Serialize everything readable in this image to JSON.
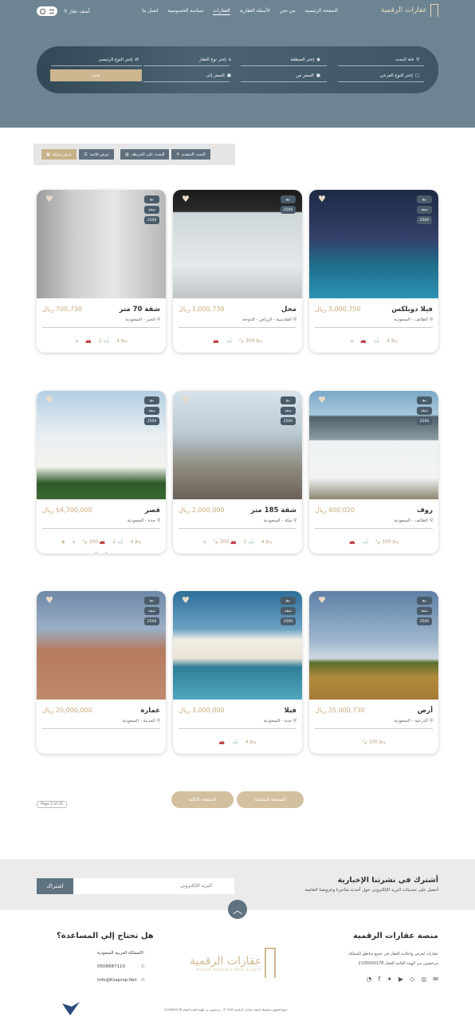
{
  "header": {
    "logo": "عقارات الرقمية",
    "nav": [
      "الصفحة الرئيسية",
      "من نحن",
      "الأسئلة العقارية",
      "العقارات",
      "سياسة الخصوصية",
      "اتصل بنا"
    ],
    "add_property": "أضف عقار"
  },
  "search": {
    "f1": "فئة البحث",
    "f2": "إختر المنطقة",
    "f3": "إختر نوع العقار",
    "f4": "إختر النوع الرئيسي",
    "f5": "إختر النوع الفرعي",
    "f6": "السعر من",
    "f7": "السعر إلى",
    "button": "بحث"
  },
  "toolbar": {
    "grid": "عرض شبكة",
    "list": "عرض قائمة",
    "map": "البحث على الخريطة",
    "advanced": "البحث المتقدم"
  },
  "listings": [
    {
      "title": "فيلا دوبلكس",
      "price": "3,000,750 ريال",
      "loc": "الطائف - السعودية",
      "tags": [
        "بيع",
        "شقة",
        "2500"
      ],
      "feats": [
        "4",
        "",
        "",
        ""
      ],
      "feats2": []
    },
    {
      "title": "محل",
      "price": "1,000,730 ريال",
      "loc": "القادسية - الرياض - الدوحة",
      "tags": [
        "بيع",
        "2500"
      ],
      "feats": [
        "300 م²",
        "",
        ""
      ],
      "feats2": []
    },
    {
      "title": "شقة 70 متر",
      "price": "700,730 ريال",
      "loc": "الخبر - السعودية",
      "tags": [
        "بيع",
        "شقة",
        "2500"
      ],
      "feats": [
        "4",
        "2",
        "",
        ""
      ],
      "feats2": []
    },
    {
      "title": "روف",
      "price": "400,020 ريال",
      "loc": "الطائف - السعودية",
      "tags": [
        "بيع",
        "شقة",
        "2500"
      ],
      "feats": [
        "300 م²",
        "",
        ""
      ],
      "feats2": []
    },
    {
      "title": "شقة 185 متر",
      "price": "2,000,000 ريال",
      "loc": "مكة - السعودية",
      "tags": [
        "بيع",
        "شقة",
        "2500"
      ],
      "feats": [
        "4",
        "2",
        "300 م²",
        ""
      ],
      "feats2": []
    },
    {
      "title": "قصر",
      "price": "$4,700,000 ريال",
      "loc": "جدة - السعودية",
      "tags": [
        "بيع",
        "شقة",
        "2500"
      ],
      "feats": [
        "4",
        "2",
        "300 م²",
        "",
        ""
      ],
      "feats2": [
        "",
        ""
      ]
    },
    {
      "title": "أرض",
      "price": "35,000,730 ريال",
      "loc": "الدرعية - السعودية",
      "tags": [
        "بيع",
        "شقة",
        "2500"
      ],
      "feats": [
        "300 م²"
      ],
      "feats2": []
    },
    {
      "title": "فيلا",
      "price": "3,000,000 ريال",
      "loc": "جدة - السعودية",
      "tags": [
        "بيع",
        "شقة",
        "2500"
      ],
      "feats": [
        "4",
        "",
        ""
      ],
      "feats2": []
    },
    {
      "title": "عمارة",
      "price": "20,000,000 ريال",
      "loc": "المدينة - السعودية",
      "tags": [
        "بيع",
        "شقة",
        "2500"
      ],
      "feats": [],
      "feats2": []
    }
  ],
  "pagination": {
    "label": "Page 2 of 45",
    "prev": "الصفحة السابقة",
    "next": "الصفحة التالية"
  },
  "newsletter": {
    "title": "أشترك في نشرتنا الإخبارية",
    "subtitle": "أحصل على تحديثات البريد الإلكتروني حول أحدث متاجرنا وعروضنا الخاصة",
    "placeholder": "البريد الإلكتروني",
    "button": "اشتراك"
  },
  "footer": {
    "about_title": "منصة عقارات الرقمية",
    "about_1": "عقارات لعرض وإعلانية العقار في جميع مناطق المملكة",
    "about_2": "مرخصون من الهيئة العامة للعقار 2100000178",
    "help_title": "هل تحتاج إلي المساعدة؟",
    "address": "المملكة العربية السعودية",
    "phone": "0506887110",
    "email": "Info@Ksaprop.Net",
    "logo": "عقارات الرقمية",
    "logo_sub": "Aqarat Raqamia Real Estate",
    "copyright": "جميع الحقوق محفوظة لمنصة عقارات الرقمية 2022 © - مرخصون من الهيئة العامة للعقار 2100000178"
  }
}
